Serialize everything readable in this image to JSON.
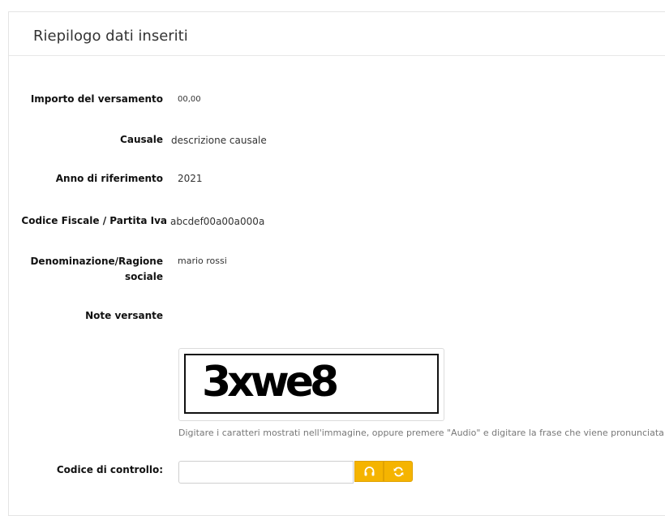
{
  "panel": {
    "title": "Riepilogo dati inseriti"
  },
  "fields": {
    "importo": {
      "label": "Importo del versamento",
      "value": "00,00"
    },
    "causale": {
      "label": "Causale",
      "value": "descrizione causale"
    },
    "anno": {
      "label": "Anno di riferimento",
      "value": "2021"
    },
    "codice_fiscale": {
      "label": "Codice Fiscale / Partita Iva",
      "value": "abcdef00a00a000a"
    },
    "denominazione": {
      "label_line1": "Denominazione/Ragione",
      "label_line2": "sociale",
      "value": "mario rossi"
    },
    "note": {
      "label": "Note versante",
      "value": ""
    }
  },
  "captcha": {
    "image_text": "3xwe8",
    "help": "Digitare i caratteri mostrati nell'immagine, oppure premere \"Audio\" e digitare la frase che viene pronunciata."
  },
  "control_code": {
    "label": "Codice di controllo:",
    "value": "",
    "audio_icon": "headphones-icon",
    "refresh_icon": "refresh-icon"
  },
  "colors": {
    "button": "#f5b400",
    "label": "#111111",
    "help": "#777777"
  }
}
